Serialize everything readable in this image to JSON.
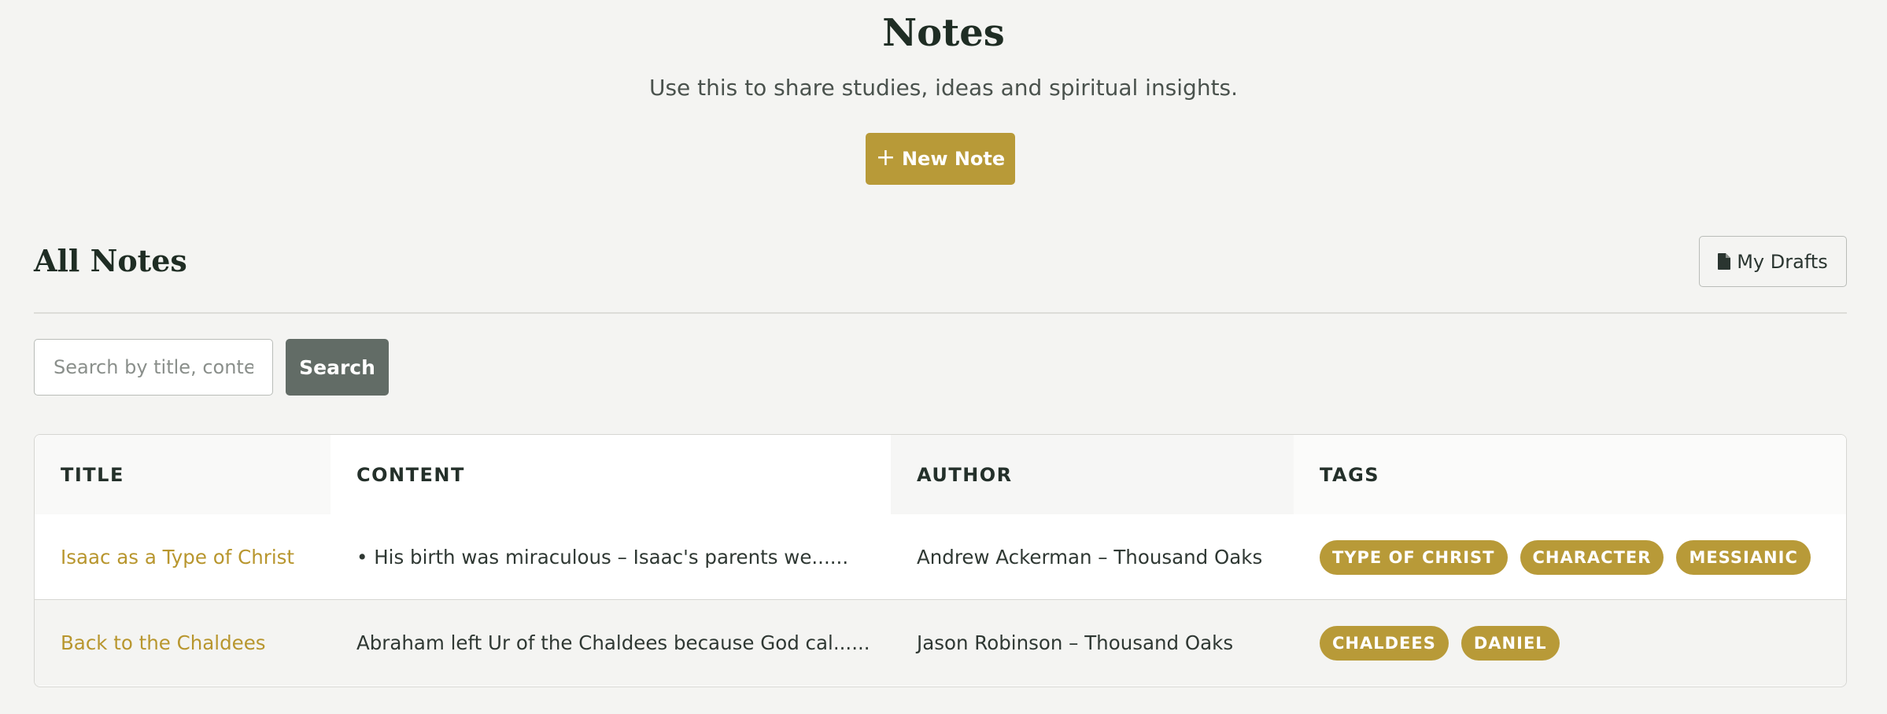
{
  "header": {
    "title": "Notes",
    "subtitle": "Use this to share studies, ideas and spiritual insights.",
    "new_note_label": "New Note",
    "new_note_icon": "plus-icon"
  },
  "section": {
    "title": "All Notes",
    "drafts_label": "My Drafts",
    "drafts_icon": "file-icon"
  },
  "search": {
    "placeholder": "Search by title, content",
    "value": "",
    "button_label": "Search"
  },
  "table": {
    "columns": [
      "TITLE",
      "CONTENT",
      "AUTHOR",
      "TAGS"
    ],
    "rows": [
      {
        "title": "Isaac as a Type of Christ",
        "content": "• His birth was miraculous – Isaac's parents we......",
        "author": "Andrew Ackerman – Thousand Oaks",
        "tags": [
          "TYPE OF CHRIST",
          "CHARACTER",
          "MESSIANIC"
        ]
      },
      {
        "title": "Back to the Chaldees",
        "content": "Abraham left Ur of the Chaldees because God cal......",
        "author": "Jason Robinson – Thousand Oaks",
        "tags": [
          "CHALDEES",
          "DANIEL"
        ]
      }
    ]
  },
  "colors": {
    "accent": "#b89a38",
    "link": "#b8962e",
    "search_button": "#626c66",
    "background": "#f4f4f2"
  }
}
